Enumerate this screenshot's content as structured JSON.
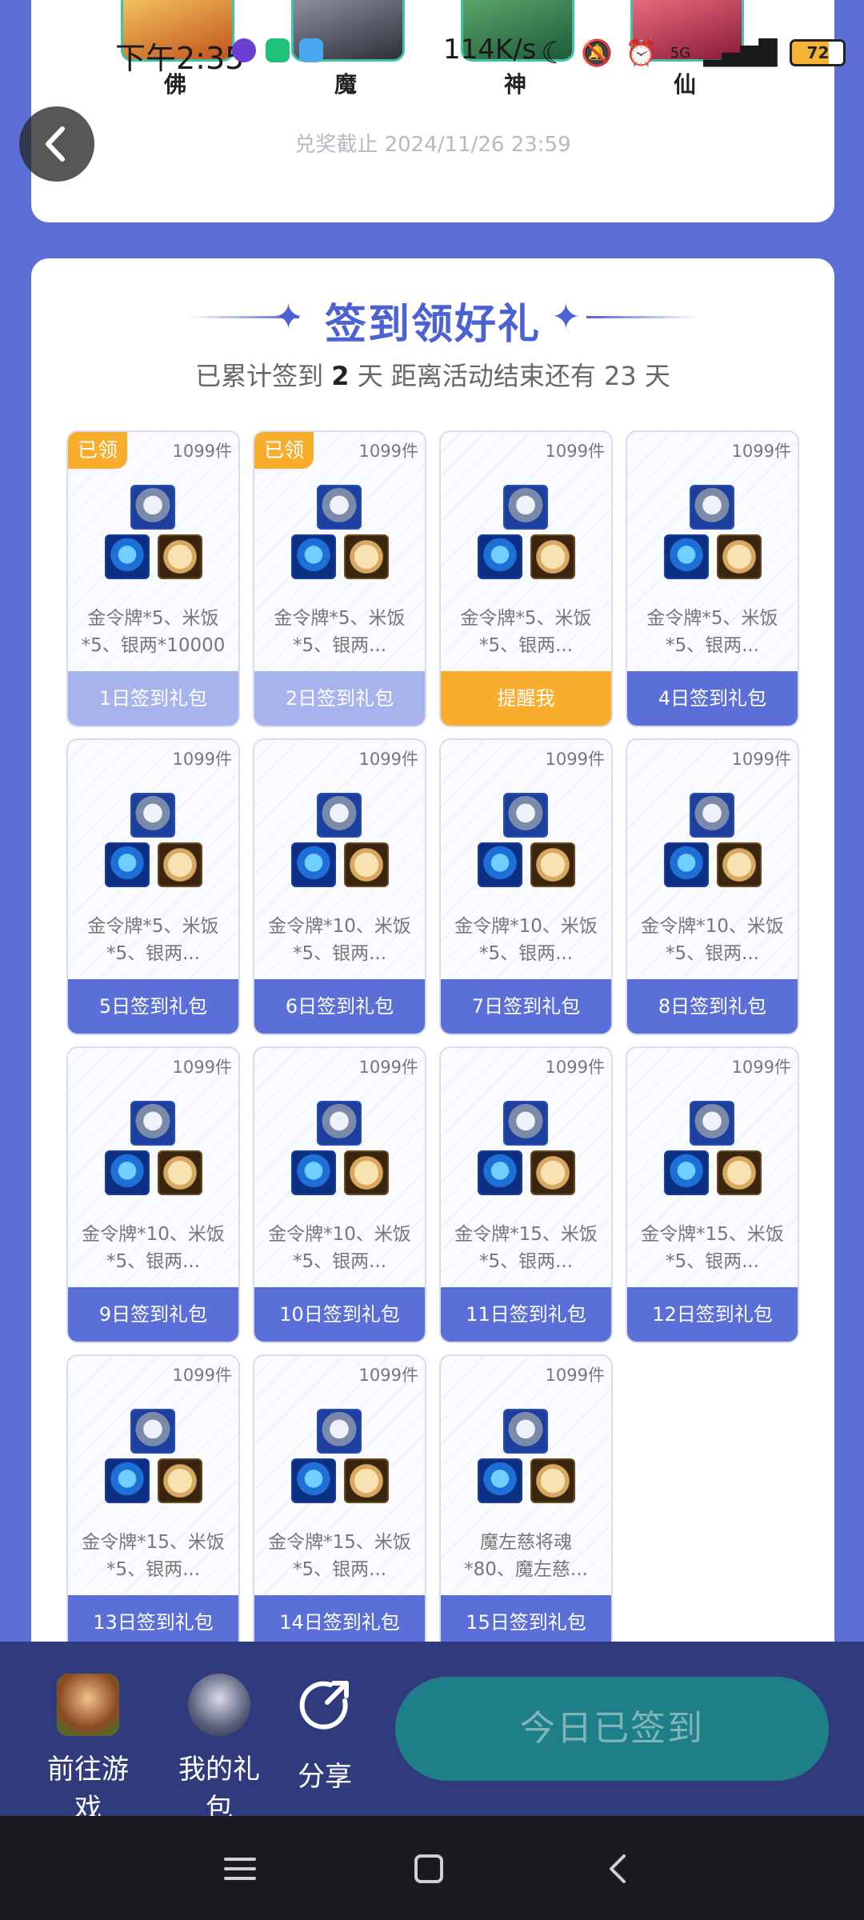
{
  "status_bar": {
    "time": "下午2:35",
    "network_speed": "114K/s",
    "signal": "5G",
    "battery": "72"
  },
  "factions": [
    "佛",
    "魔",
    "神",
    "仙"
  ],
  "deadline": "兑奖截止 2024/11/26 23:59",
  "signin": {
    "title": "签到领好礼",
    "subtitle_prefix": "已累计签到",
    "days_signed": "2",
    "subtitle_mid": "天  距离活动结束还有 23 天"
  },
  "tiles": [
    {
      "qty": "1099件",
      "claimed": "已领",
      "desc": "金令牌*5、米饭\n*5、银两*10000",
      "button": "1日签到礼包",
      "state": "done"
    },
    {
      "qty": "1099件",
      "claimed": "已领",
      "desc": "金令牌*5、米饭\n*5、银两...",
      "button": "2日签到礼包",
      "state": "done"
    },
    {
      "qty": "1099件",
      "claimed": "",
      "desc": "金令牌*5、米饭\n*5、银两...",
      "button": "提醒我",
      "state": "remind"
    },
    {
      "qty": "1099件",
      "claimed": "",
      "desc": "金令牌*5、米饭\n*5、银两...",
      "button": "4日签到礼包",
      "state": "normal"
    },
    {
      "qty": "1099件",
      "claimed": "",
      "desc": "金令牌*5、米饭\n*5、银两...",
      "button": "5日签到礼包",
      "state": "normal"
    },
    {
      "qty": "1099件",
      "claimed": "",
      "desc": "金令牌*10、米饭\n*5、银两...",
      "button": "6日签到礼包",
      "state": "normal"
    },
    {
      "qty": "1099件",
      "claimed": "",
      "desc": "金令牌*10、米饭\n*5、银两...",
      "button": "7日签到礼包",
      "state": "normal"
    },
    {
      "qty": "1099件",
      "claimed": "",
      "desc": "金令牌*10、米饭\n*5、银两...",
      "button": "8日签到礼包",
      "state": "normal"
    },
    {
      "qty": "1099件",
      "claimed": "",
      "desc": "金令牌*10、米饭\n*5、银两...",
      "button": "9日签到礼包",
      "state": "normal"
    },
    {
      "qty": "1099件",
      "claimed": "",
      "desc": "金令牌*10、米饭\n*5、银两...",
      "button": "10日签到礼包",
      "state": "normal"
    },
    {
      "qty": "1099件",
      "claimed": "",
      "desc": "金令牌*15、米饭\n*5、银两...",
      "button": "11日签到礼包",
      "state": "normal"
    },
    {
      "qty": "1099件",
      "claimed": "",
      "desc": "金令牌*15、米饭\n*5、银两...",
      "button": "12日签到礼包",
      "state": "normal"
    },
    {
      "qty": "1099件",
      "claimed": "",
      "desc": "金令牌*15、米饭\n*5、银两...",
      "button": "13日签到礼包",
      "state": "normal"
    },
    {
      "qty": "1099件",
      "claimed": "",
      "desc": "金令牌*15、米饭\n*5、银两...",
      "button": "14日签到礼包",
      "state": "normal"
    },
    {
      "qty": "1099件",
      "claimed": "",
      "desc": "魔左慈将魂\n*80、魔左慈...",
      "button": "15日签到礼包",
      "state": "normal"
    }
  ],
  "bottom_bar": {
    "goto_game": "前往游戏",
    "my_gifts": "我的礼包",
    "share": "分享",
    "signed_button": "今日已签到"
  },
  "colors": {
    "page_bg": "#5d6fd6",
    "accent": "#4c62d2",
    "button": "#5a6fd8",
    "button_done": "#a7b3ec",
    "remind": "#f9ad2c",
    "bottom_bar": "#2f3b7c",
    "signed_button": "#1f7f88"
  }
}
